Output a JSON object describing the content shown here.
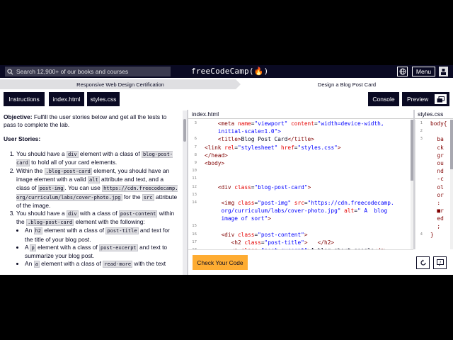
{
  "nav": {
    "search_placeholder": "Search 12,900+ of our books and courses",
    "brand": "freeCodeCamp(🔥)",
    "menu_label": "Menu"
  },
  "breadcrumb": {
    "certification": "Responsive Web Design Certification",
    "lab": "Design a Blog Post Card"
  },
  "toolbar": {
    "instructions": "Instructions",
    "index_html": "index.html",
    "styles_css": "styles.css",
    "console": "Console",
    "preview": "Preview"
  },
  "instructions": {
    "objective_label": "Objective:",
    "objective_text": " Fulfill the user stories below and get all the tests to pass to complete the lab.",
    "user_stories_heading": "User Stories:",
    "s1_a": "You should have a ",
    "s1_code1": "div",
    "s1_b": " element with a class of ",
    "s1_code2": "blog-post-card",
    "s1_c": " to hold all of your card elements.",
    "s2_a": "Within the ",
    "s2_code1": ".blog-post-card",
    "s2_b": " element, you should have an image element with a valid ",
    "s2_code2": "alt",
    "s2_c": " attribute and text, and a class of ",
    "s2_code3": "post-img",
    "s2_d": ". You can use ",
    "s2_code4": "https://cdn.freecodecamp.org/curriculum/labs/cover-photo.jpg",
    "s2_e": " for the ",
    "s2_code5": "src",
    "s2_f": " attribute of the image.",
    "s3_a": "You should have a ",
    "s3_code1": "div",
    "s3_b": " with a class of ",
    "s3_code2": "post-content",
    "s3_c": " within the ",
    "s3_code3": ".blog-post-card",
    "s3_d": " element with the following:",
    "sub1_a": "An ",
    "sub1_code1": "h2",
    "sub1_b": " element with a class of ",
    "sub1_code2": "post-title",
    "sub1_c": " and text for the title of your blog post.",
    "sub2_a": "A ",
    "sub2_code1": "p",
    "sub2_b": " element with a class of ",
    "sub2_code2": "post-excerpt",
    "sub2_c": " and text to summarize your blog post.",
    "sub3_a": "An ",
    "sub3_code1": "a",
    "sub3_b": " element with a class of ",
    "sub3_code2": "read-more",
    "sub3_c": " with the text"
  },
  "editor": {
    "filename": "index.html",
    "lines": [
      {
        "n": "3",
        "segs": [
          {
            "t": "    ",
            "c": "c-txt"
          },
          {
            "t": "<meta ",
            "c": "c-tag"
          },
          {
            "t": "name",
            "c": "c-attr"
          },
          {
            "t": "=",
            "c": "c-txt"
          },
          {
            "t": "\"viewport\"",
            "c": "c-val"
          },
          {
            "t": " content",
            "c": "c-attr"
          },
          {
            "t": "=",
            "c": "c-txt"
          },
          {
            "t": "\"width=device-width,",
            "c": "c-val"
          }
        ]
      },
      {
        "n": "",
        "segs": [
          {
            "t": "    initial-scale=1.0\">",
            "c": "c-val"
          }
        ]
      },
      {
        "n": "6",
        "segs": [
          {
            "t": "    ",
            "c": "c-txt"
          },
          {
            "t": "<title>",
            "c": "c-tag"
          },
          {
            "t": "Blog Post Card",
            "c": "c-txt"
          },
          {
            "t": "</title>",
            "c": "c-tag"
          }
        ]
      },
      {
        "n": "7",
        "segs": [
          {
            "t": "<link ",
            "c": "c-tag"
          },
          {
            "t": "rel",
            "c": "c-attr"
          },
          {
            "t": "=",
            "c": "c-txt"
          },
          {
            "t": "\"stylesheet\"",
            "c": "c-val"
          },
          {
            "t": " href",
            "c": "c-attr"
          },
          {
            "t": "=",
            "c": "c-txt"
          },
          {
            "t": "\"styles.css\"",
            "c": "c-val"
          },
          {
            "t": ">",
            "c": "c-tag"
          }
        ]
      },
      {
        "n": "8",
        "segs": [
          {
            "t": "</head>",
            "c": "c-tag"
          }
        ]
      },
      {
        "n": "9",
        "segs": [
          {
            "t": "<body>",
            "c": "c-tag"
          }
        ]
      },
      {
        "n": "10",
        "segs": []
      },
      {
        "n": "11",
        "segs": []
      },
      {
        "n": "12",
        "segs": [
          {
            "t": "    ",
            "c": "c-txt"
          },
          {
            "t": "<div ",
            "c": "c-tag"
          },
          {
            "t": "class",
            "c": "c-attr"
          },
          {
            "t": "=",
            "c": "c-txt"
          },
          {
            "t": "\"blog-post-card\"",
            "c": "c-val"
          },
          {
            "t": ">",
            "c": "c-tag"
          }
        ]
      },
      {
        "n": "13",
        "segs": []
      },
      {
        "n": "14",
        "segs": [
          {
            "t": "     ",
            "c": "c-txt"
          },
          {
            "t": "<img ",
            "c": "c-tag"
          },
          {
            "t": "class",
            "c": "c-attr"
          },
          {
            "t": "=",
            "c": "c-txt"
          },
          {
            "t": "\"post-img\"",
            "c": "c-val"
          },
          {
            "t": " src",
            "c": "c-attr"
          },
          {
            "t": "=",
            "c": "c-txt"
          },
          {
            "t": "\"https://cdn.freecodecamp.",
            "c": "c-val"
          }
        ]
      },
      {
        "n": "",
        "segs": [
          {
            "t": "     org/curriculum/labs/cover-photo.jpg\"",
            "c": "c-val"
          },
          {
            "t": " alt",
            "c": "c-attr"
          },
          {
            "t": "=",
            "c": "c-txt"
          },
          {
            "t": "\" A  blog",
            "c": "c-val"
          }
        ]
      },
      {
        "n": "",
        "segs": [
          {
            "t": "     image of sort\"",
            "c": "c-val"
          },
          {
            "t": ">",
            "c": "c-tag"
          }
        ]
      },
      {
        "n": "15",
        "segs": []
      },
      {
        "n": "16",
        "segs": [
          {
            "t": "     ",
            "c": "c-txt"
          },
          {
            "t": "<div ",
            "c": "c-tag"
          },
          {
            "t": "class",
            "c": "c-attr"
          },
          {
            "t": "=",
            "c": "c-txt"
          },
          {
            "t": "\"post-content\"",
            "c": "c-val"
          },
          {
            "t": ">",
            "c": "c-tag"
          }
        ]
      },
      {
        "n": "17",
        "segs": [
          {
            "t": "        ",
            "c": "c-txt"
          },
          {
            "t": "<h2 ",
            "c": "c-tag"
          },
          {
            "t": "class",
            "c": "c-attr"
          },
          {
            "t": "=",
            "c": "c-txt"
          },
          {
            "t": "\"post-title\"",
            "c": "c-val"
          },
          {
            "t": ">   ",
            "c": "c-tag"
          },
          {
            "t": "</h2>",
            "c": "c-tag"
          }
        ]
      },
      {
        "n": "18",
        "segs": [
          {
            "t": "        ",
            "c": "c-txt"
          },
          {
            "t": "<p ",
            "c": "c-tag"
          },
          {
            "t": "class",
            "c": "c-attr"
          },
          {
            "t": "=",
            "c": "c-txt"
          },
          {
            "t": "\"post-excerpt\"",
            "c": "c-val"
          },
          {
            "t": ">",
            "c": "c-tag"
          },
          {
            "t": "A blog about google",
            "c": "c-txt"
          },
          {
            "t": "</p>",
            "c": "c-tag"
          }
        ]
      }
    ]
  },
  "css_panel": {
    "filename": "styles.css",
    "lines": [
      {
        "n": "1",
        "t": "body{"
      },
      {
        "n": "2",
        "t": ""
      },
      {
        "n": "3",
        "t": "  ba"
      },
      {
        "n": "",
        "t": "  ck"
      },
      {
        "n": "",
        "t": "  gr"
      },
      {
        "n": "",
        "t": "  ou"
      },
      {
        "n": "",
        "t": "  nd"
      },
      {
        "n": "",
        "t": "  -c"
      },
      {
        "n": "",
        "t": "  ol"
      },
      {
        "n": "",
        "t": "  or"
      },
      {
        "n": "",
        "t": "  :"
      },
      {
        "n": "",
        "t": "  ■r"
      },
      {
        "n": "",
        "t": "  ed"
      },
      {
        "n": "",
        "t": "  ;"
      },
      {
        "n": "4",
        "t": "}"
      }
    ]
  },
  "footer": {
    "check_label": "Check Your Code"
  },
  "colors": {
    "nav_bg": "#0a0a23",
    "check_btn": "#feac32",
    "search_bg": "#3b3b4f"
  }
}
